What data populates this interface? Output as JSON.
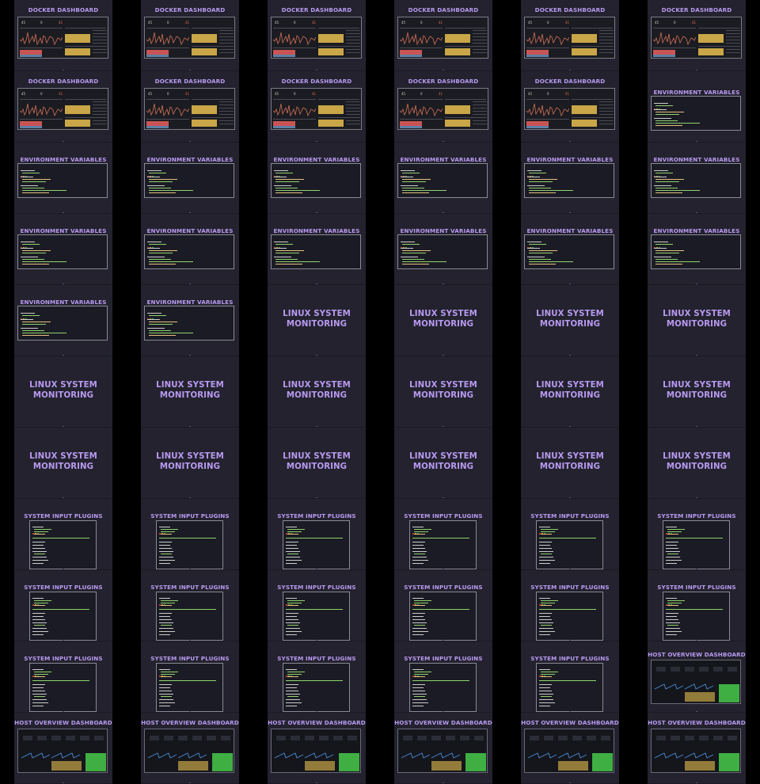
{
  "slide_titles": {
    "docker": "DOCKER DASHBOARD",
    "env": "ENVIRONMENT VARIABLES",
    "linux": "LINUX SYSTEM MONITORING",
    "plugins": "SYSTEM INPUT PLUGINS",
    "host": "HOST OVERVIEW DASHBOARD"
  },
  "docker_kpis": [
    "45",
    "0",
    "41"
  ],
  "columns": [
    {
      "id": "col-1",
      "slides": [
        "docker",
        "docker",
        "env",
        "env",
        "env",
        "linux",
        "linux",
        "plugins",
        "plugins",
        "plugins",
        "host"
      ]
    },
    {
      "id": "col-2",
      "slides": [
        "docker",
        "docker",
        "env",
        "env",
        "env",
        "linux",
        "linux",
        "plugins",
        "plugins",
        "plugins",
        "host"
      ]
    },
    {
      "id": "col-3",
      "slides": [
        "docker",
        "docker",
        "env",
        "env",
        "linux",
        "linux",
        "linux",
        "plugins",
        "plugins",
        "plugins",
        "host"
      ]
    },
    {
      "id": "col-4",
      "slides": [
        "docker",
        "docker",
        "env",
        "env",
        "linux",
        "linux",
        "linux",
        "plugins",
        "plugins",
        "plugins",
        "host"
      ]
    },
    {
      "id": "col-5",
      "slides": [
        "docker",
        "docker",
        "env",
        "env",
        "linux",
        "linux",
        "linux",
        "plugins",
        "plugins",
        "plugins",
        "host"
      ]
    },
    {
      "id": "col-6",
      "slides": [
        "docker",
        "env",
        "env",
        "env",
        "linux",
        "linux",
        "linux",
        "plugins",
        "plugins",
        "host",
        "host"
      ]
    }
  ],
  "colors": {
    "background": "#000000",
    "column": "#23222e",
    "title": "#b89af0",
    "accent_yellow": "#c9a647",
    "accent_red": "#c95454",
    "accent_green": "#3fae43",
    "code_green": "#8fd36a",
    "code_yellow": "#e5c07b"
  }
}
